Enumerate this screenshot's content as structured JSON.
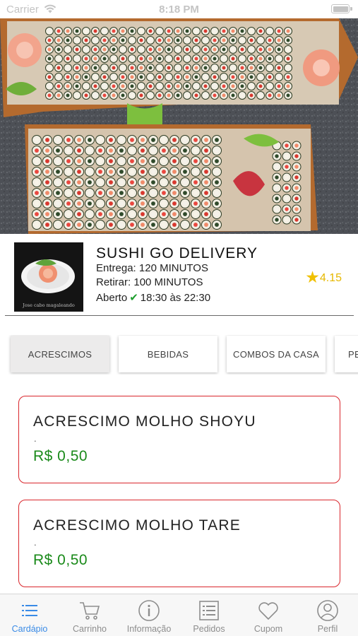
{
  "status_bar": {
    "carrier": "Carrier",
    "time": "8:18 PM",
    "battery_level": 1.0
  },
  "store": {
    "name": "SUSHI GO DELIVERY",
    "delivery_label": "Entrega:",
    "delivery_time": "120 MINUTOS",
    "pickup_label": "Retirar:",
    "pickup_time": "100 MINUTOS",
    "status": "Aberto",
    "hours": "18:30 às 22:30",
    "rating": "4.15",
    "logo_caption": "Jose cabo magaleando"
  },
  "tabs": [
    {
      "label": "ACRESCIMOS",
      "active": true
    },
    {
      "label": "BEBIDAS",
      "active": false
    },
    {
      "label": "COMBOS DA CASA",
      "active": false
    },
    {
      "label": "PE",
      "active": false
    }
  ],
  "products": [
    {
      "name": "ACRESCIMO MOLHO SHOYU",
      "description": ".",
      "price": "R$ 0,50"
    },
    {
      "name": "ACRESCIMO MOLHO TARE",
      "description": ".",
      "price": "R$ 0,50"
    }
  ],
  "nav": [
    {
      "label": "Cardápio",
      "icon": "menu-list-icon",
      "active": true
    },
    {
      "label": "Carrinho",
      "icon": "cart-icon",
      "active": false
    },
    {
      "label": "Informação",
      "icon": "info-icon",
      "active": false
    },
    {
      "label": "Pedidos",
      "icon": "orders-icon",
      "active": false
    },
    {
      "label": "Cupom",
      "icon": "heart-icon",
      "active": false
    },
    {
      "label": "Perfil",
      "icon": "profile-icon",
      "active": false
    }
  ],
  "colors": {
    "accent": "#3a8be6",
    "card_border": "#d9262c",
    "price": "#1a8a1a",
    "rating": "#f0c000",
    "open_check": "#1e9e2e"
  }
}
